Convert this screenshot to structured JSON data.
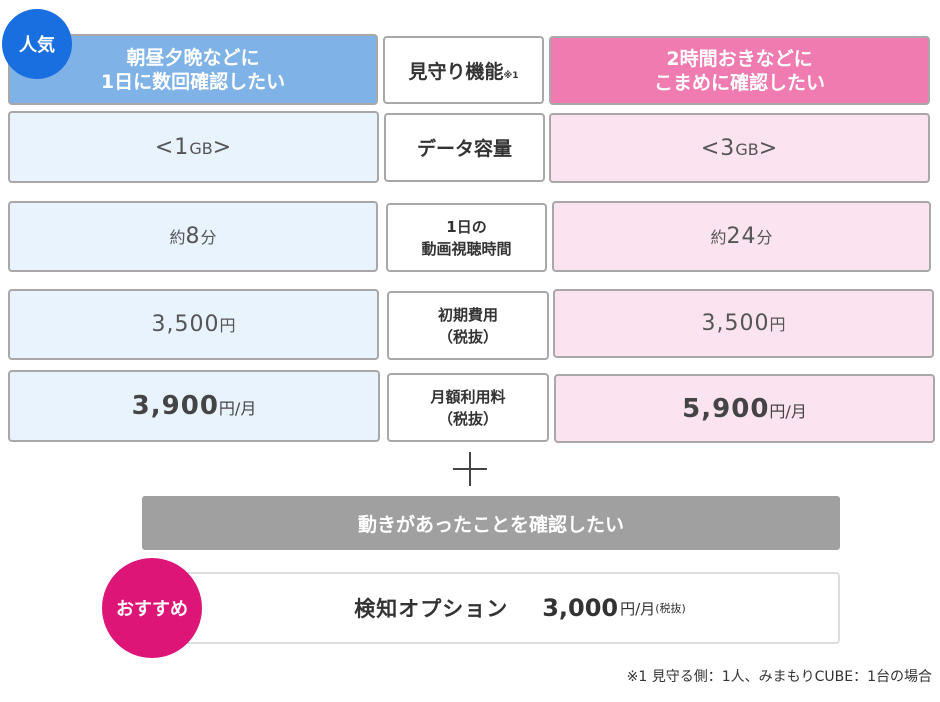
{
  "badges": {
    "popular": "人気",
    "recommend": "おすすめ"
  },
  "header": {
    "left_line1": "朝昼夕晩などに",
    "left_line2": "1日に数回確認したい",
    "mid_label": "見守り機能",
    "mid_note": "※1",
    "right_line1": "2時間おきなどに",
    "right_line2": "こまめに確認したい"
  },
  "rows": {
    "data": {
      "label": "データ容量",
      "left_open": "<1",
      "left_unit": "GB",
      "left_close": ">",
      "right_open": "<3",
      "right_unit": "GB",
      "right_close": ">"
    },
    "video": {
      "label_line1": "1日の",
      "label_line2": "動画視聴時間",
      "left_prefix": "約",
      "left_value": "8",
      "left_unit": "分",
      "right_prefix": "約",
      "right_value": "24",
      "right_unit": "分"
    },
    "initial": {
      "label_line1": "初期費用",
      "label_line2": "（税抜）",
      "left_value": "3,500",
      "left_unit": "円",
      "right_value": "3,500",
      "right_unit": "円"
    },
    "monthly": {
      "label_line1": "月額利用料",
      "label_line2": "（税抜）",
      "left_value": "3,900",
      "left_unit": "円/月",
      "right_value": "5,900",
      "right_unit": "円/月"
    }
  },
  "plus": "＋",
  "motion": {
    "label": "動きがあったことを確認したい"
  },
  "option": {
    "name": "検知オプション",
    "price": "3,000",
    "unit": "円/月",
    "tax": "(税抜)"
  },
  "footnote": "※1 見守る側：1人、みまもりCUBE：1台の場合",
  "colors": {
    "left_header": "#7fb2e6",
    "right_header": "#f07bb1",
    "left_cell": "#e8f3fd",
    "right_cell": "#fbe4ef",
    "popular_badge": "#1a6fe0",
    "recommend_badge": "#dc1577",
    "motion_bar": "#a0a0a0"
  }
}
